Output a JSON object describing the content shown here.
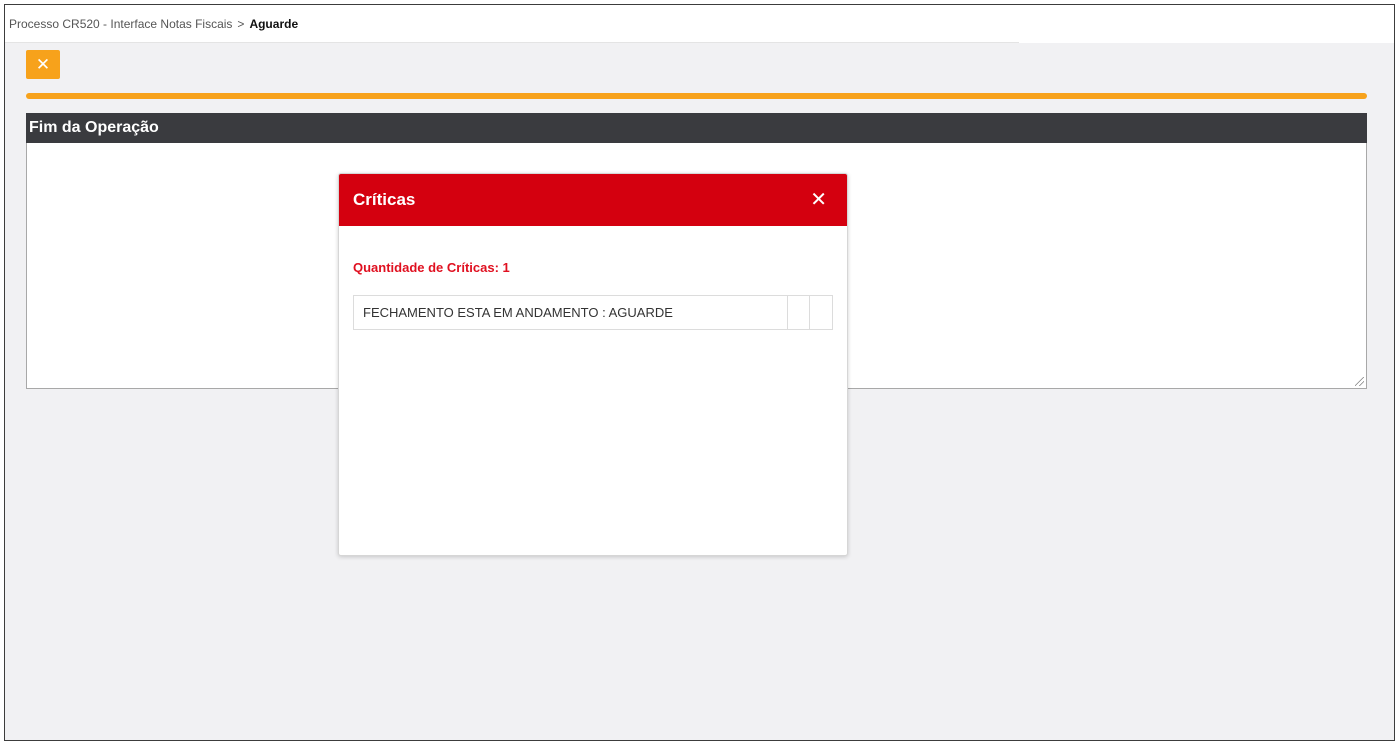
{
  "breadcrumb": {
    "parent": "Processo CR520 - Interface Notas Fiscais",
    "separator": ">",
    "current": "Aguarde"
  },
  "toolbar": {
    "close_glyph": "✕"
  },
  "panel": {
    "title": "Fim da Operação"
  },
  "modal": {
    "title": "Críticas",
    "close_glyph": "✕",
    "count_label": "Quantidade de Críticas: 1",
    "rows": [
      {
        "message": "FECHAMENTO ESTA EM ANDAMENTO : AGUARDE"
      }
    ]
  },
  "colors": {
    "accent_orange": "#f7a21b",
    "modal_header_red": "#d4000f",
    "panel_header_dark": "#3a3b3f",
    "count_text_red": "#e01020"
  },
  "icons": [
    "close-icon",
    "modal-close-icon",
    "resize-grip-icon"
  ]
}
